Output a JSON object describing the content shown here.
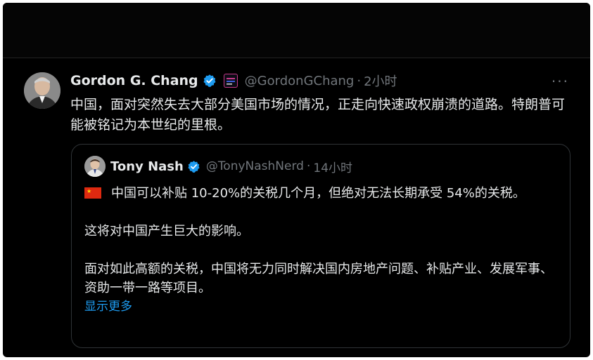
{
  "tweet": {
    "author_name": "Gordon G. Chang",
    "author_handle": "@GordonGChang",
    "separator": "·",
    "time": "2小时",
    "more_label": "···",
    "text": "中国，面对突然失去大部分美国市场的情况，正走向快速政权崩溃的道路。特朗普可能被铭记为本世纪的里根。",
    "icons": {
      "verified": "verified-badge-icon",
      "affiliation": "affiliation-badge-icon",
      "more": "more-options-icon"
    }
  },
  "quoted": {
    "author_name": "Tony Nash",
    "author_handle": "@TonyNashNerd",
    "separator": "·",
    "time": "14小时",
    "flag_icon": "china-flag-icon",
    "paragraphs": [
      "中国可以补贴 10-20%的关税几个月，但绝对无法长期承受 54%的关税。",
      "这将对中国产生巨大的影响。",
      "面对如此高额的关税，中国将无力同时解决国内房地产问题、补贴产业、发展军事、资助一带一路等项目。"
    ],
    "show_more": "显示更多"
  },
  "colors": {
    "background": "#000000",
    "text_primary": "#e7e9ea",
    "text_secondary": "#71767b",
    "link": "#1d9bf0",
    "verified": "#1d9bf0",
    "border": "#2f3336"
  }
}
